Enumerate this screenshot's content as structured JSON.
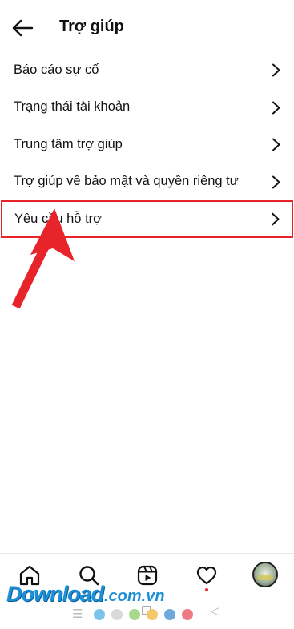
{
  "header": {
    "title": "Trợ giúp"
  },
  "menu": {
    "items": [
      {
        "label": "Báo cáo sự cố"
      },
      {
        "label": "Trạng thái tài khoản"
      },
      {
        "label": "Trung tâm trợ giúp"
      },
      {
        "label": "Trợ giúp về bảo mật và quyền riêng tư"
      },
      {
        "label": "Yêu cầu hỗ trợ",
        "highlighted": true
      }
    ]
  },
  "bottom_nav": {
    "items": [
      "home-icon",
      "search-icon",
      "reels-icon",
      "heart-icon",
      "profile-avatar"
    ]
  },
  "watermark": {
    "brand": "Download",
    "tld": ".com.vn"
  },
  "colors": {
    "highlight_border": "#e8242b",
    "arrow": "#e8242b",
    "watermark": "#1d8fd6",
    "dots": [
      "#7cc3ec",
      "#d9d9d9",
      "#a6d98c",
      "#f3c96b",
      "#6fa8dc",
      "#ee7b84"
    ]
  }
}
